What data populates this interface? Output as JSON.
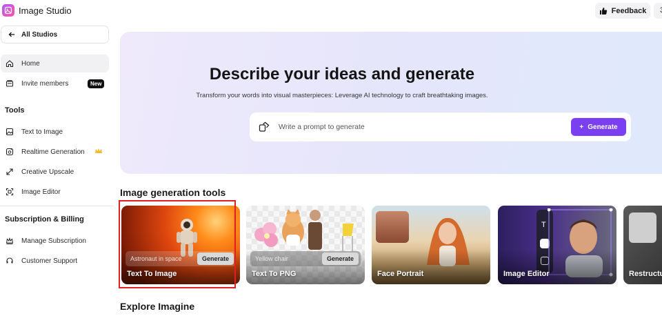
{
  "app": {
    "title": "Image Studio"
  },
  "topbar": {
    "feedback_label": "Feedback",
    "extra_label": "3"
  },
  "sidebar": {
    "back_label": "All Studios",
    "items": [
      {
        "label": "Home",
        "icon": "home-icon"
      },
      {
        "label": "Invite members",
        "icon": "invite-icon",
        "badge": "New"
      }
    ],
    "tools_title": "Tools",
    "tools": [
      {
        "label": "Text to Image",
        "icon": "image-icon"
      },
      {
        "label": "Realtime Generation",
        "icon": "realtime-icon",
        "premium": true
      },
      {
        "label": "Creative Upscale",
        "icon": "upscale-icon"
      },
      {
        "label": "Image Editor",
        "icon": "editor-icon"
      }
    ],
    "billing_title": "Subscription & Billing",
    "billing": [
      {
        "label": "Manage Subscription",
        "icon": "crown-icon"
      },
      {
        "label": "Customer Support",
        "icon": "headset-icon"
      }
    ]
  },
  "hero": {
    "title": "Describe your ideas and generate",
    "subtitle": "Transform your words into visual masterpieces: Leverage AI technology to craft breathtaking images.",
    "prompt_placeholder": "Write a prompt to generate",
    "generate_label": "Generate"
  },
  "sections": {
    "tools_heading": "Image generation tools",
    "explore_heading": "Explore Imagine"
  },
  "cards": [
    {
      "label": "Text To Image",
      "prompt_placeholder": "Astronaut in space",
      "button": "Generate",
      "selected": true
    },
    {
      "label": "Text To PNG",
      "prompt_placeholder": "Yellow chair",
      "button": "Generate"
    },
    {
      "label": "Face Portrait"
    },
    {
      "label": "Image Editor"
    },
    {
      "label": "Restructu"
    }
  ],
  "colors": {
    "accent": "#7b3ff2",
    "highlight": "#e02020",
    "premium": "#f5b93a"
  }
}
